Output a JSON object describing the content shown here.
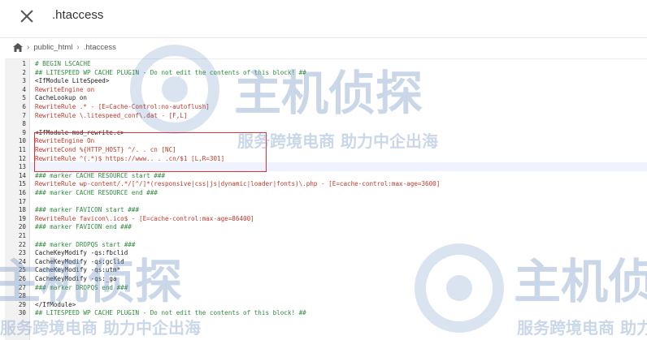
{
  "header": {
    "title": ".htaccess"
  },
  "breadcrumb": {
    "items": [
      "public_html",
      ".htaccess"
    ]
  },
  "watermark": {
    "brand": "主机侦探",
    "slogan": "服务跨境电商 助力中企出海"
  },
  "editor": {
    "lines": [
      {
        "num": "1",
        "text": "# BEGIN LSCACHE"
      },
      {
        "num": "2",
        "text": "## LITESPEED WP CACHE PLUGIN - Do not edit the contents of this block! ##"
      },
      {
        "num": "3",
        "text": "<IfModule LiteSpeed>"
      },
      {
        "num": "4",
        "text": "RewriteEngine on"
      },
      {
        "num": "5",
        "text": "CacheLookup on"
      },
      {
        "num": "6",
        "text": "RewriteRule .* - [E=Cache-Control:no-autoflush]"
      },
      {
        "num": "7",
        "text": "RewriteRule \\.litespeed_conf\\.dat - [F,L]"
      },
      {
        "num": "8",
        "text": ""
      },
      {
        "num": "9",
        "text": "<IfModule mod_rewrite.c>"
      },
      {
        "num": "10",
        "text": "RewriteEngine On"
      },
      {
        "num": "11",
        "text": "RewriteCond %{HTTP_HOST} ^/. . cn [NC]"
      },
      {
        "num": "12",
        "text": "RewriteRule ^(.*)$ https://www.. . .cn/$1 [L,R=301]"
      },
      {
        "num": "13",
        "text": ""
      },
      {
        "num": "14",
        "text": "### marker CACHE RESOURCE start ###"
      },
      {
        "num": "15",
        "text": "RewriteRule wp-content/.*/[^/]*(responsive|css|js|dynamic|loader|fonts)\\.php - [E=cache-control:max-age=3600]"
      },
      {
        "num": "16",
        "text": "### marker CACHE RESOURCE end ###"
      },
      {
        "num": "17",
        "text": ""
      },
      {
        "num": "18",
        "text": "### marker FAVICON start ###"
      },
      {
        "num": "19",
        "text": "RewriteRule favicon\\.ico$ - [E=cache-control:max-age=86400]"
      },
      {
        "num": "20",
        "text": "### marker FAVICON end ###"
      },
      {
        "num": "21",
        "text": ""
      },
      {
        "num": "22",
        "text": "### marker DROPQS start ###"
      },
      {
        "num": "23",
        "text": "CacheKeyModify -qs:fbclid"
      },
      {
        "num": "24",
        "text": "CacheKeyModify -qs:gclid"
      },
      {
        "num": "25",
        "text": "CacheKeyModify -qs:utm*"
      },
      {
        "num": "26",
        "text": "CacheKeyModify -qs:_ga"
      },
      {
        "num": "27",
        "text": "### marker DROPQS end ###"
      },
      {
        "num": "28",
        "text": ""
      },
      {
        "num": "29",
        "text": "</IfModule>"
      },
      {
        "num": "30",
        "text": "## LITESPEED WP CACHE PLUGIN - Do not edit the contents of this block! ##"
      }
    ]
  }
}
